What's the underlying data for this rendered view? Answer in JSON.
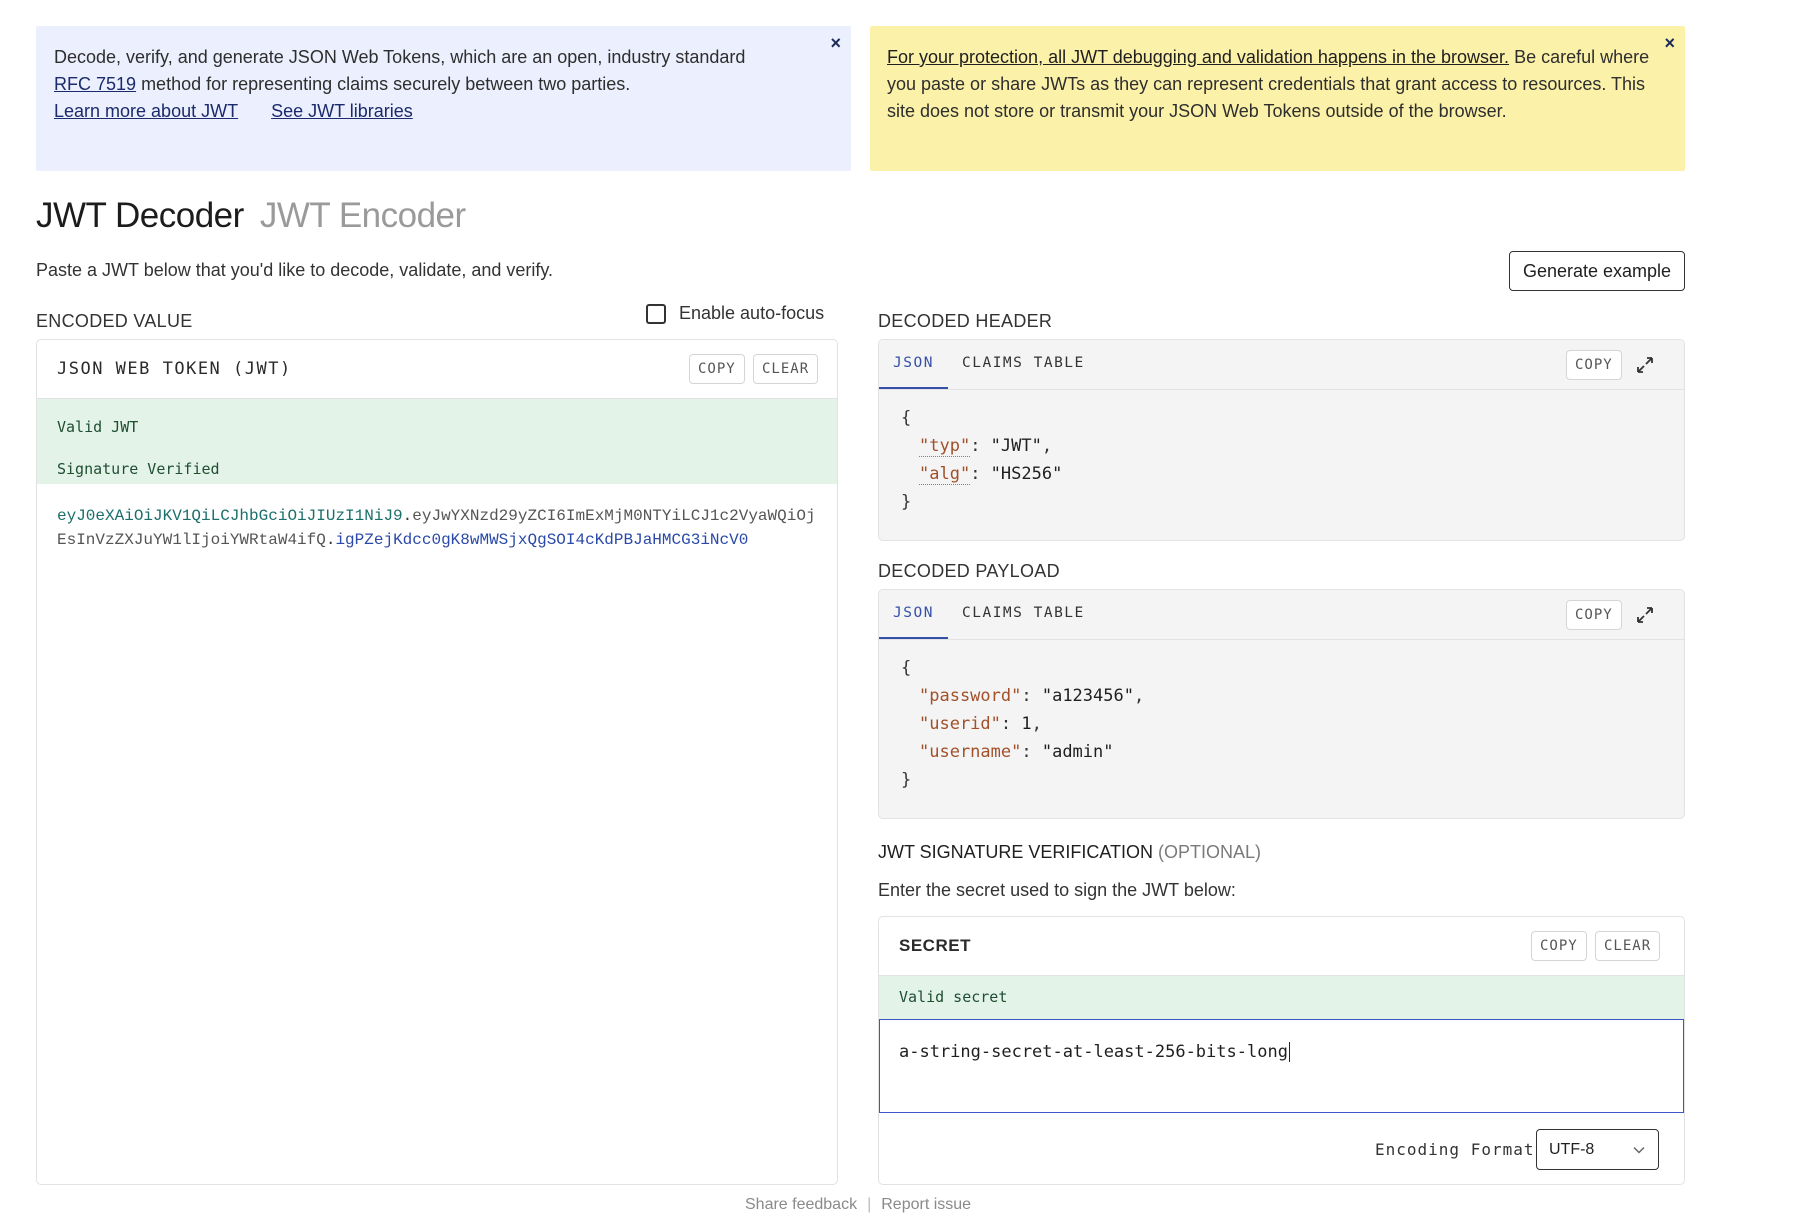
{
  "info_banner": {
    "text_before_link": "Decode, verify, and generate JSON Web Tokens, which are an open, industry standard",
    "rfc_link": "RFC 7519",
    "text_after_link": "method for representing claims securely between two parties.",
    "learn_more": "Learn more about JWT",
    "see_libraries": "See JWT libraries",
    "close": "×"
  },
  "warning_banner": {
    "lead": "For your protection, all JWT debugging and validation happens in the browser.",
    "text": "Be careful where you paste or share JWTs as they can represent credentials that grant access to resources. This site does not store or transmit your JSON Web Tokens outside of the browser.",
    "close": "×"
  },
  "title_tabs": {
    "decoder": "JWT Decoder",
    "encoder": "JWT Encoder"
  },
  "intro": "Paste a JWT below that you'd like to decode, validate, and verify.",
  "generate_example": "Generate example",
  "encoded": {
    "section_label": "ENCODED VALUE",
    "autofocus_label": "Enable auto-focus",
    "panel_title": "JSON WEB TOKEN (JWT)",
    "copy": "COPY",
    "clear": "CLEAR",
    "status_valid": "Valid JWT",
    "status_signature": "Signature Verified",
    "token_header": "eyJ0eXAiOiJKV1QiLCJhbGciOiJIUzI1NiJ9",
    "token_payload": "eyJwYXNzd29yZCI6ImExMjM0NTYiLCJ1c2VyaWQiOjEsInVzZXJuYW1lIjoiYWRtaW4ifQ",
    "token_signature": "igPZejKdcc0gK8wMWSjxQgSOI4cKdPBJaHMCG3iNcV0",
    "dot": "."
  },
  "decoded_header": {
    "section_label": "DECODED HEADER",
    "tab_json": "JSON",
    "tab_claims": "CLAIMS TABLE",
    "copy": "COPY",
    "open_brace": "{",
    "close_brace": "}",
    "line1_key": "\"typ\"",
    "line1_value": "\"JWT\"",
    "line2_key": "\"alg\"",
    "line2_value": "\"HS256\""
  },
  "decoded_payload": {
    "section_label": "DECODED PAYLOAD",
    "tab_json": "JSON",
    "tab_claims": "CLAIMS TABLE",
    "copy": "COPY",
    "open_brace": "{",
    "close_brace": "}",
    "line1_key": "\"password\"",
    "line1_value": "\"a123456\"",
    "line2_key": "\"userid\"",
    "line2_value": "1",
    "line3_key": "\"username\"",
    "line3_value": "\"admin\""
  },
  "signature": {
    "title": "JWT SIGNATURE VERIFICATION",
    "optional": "(OPTIONAL)",
    "description": "Enter the secret used to sign the JWT below:",
    "panel_title": "SECRET",
    "copy": "COPY",
    "clear": "CLEAR",
    "status": "Valid secret",
    "secret_value": "a-string-secret-at-least-256-bits-long",
    "encoding_label": "Encoding Format",
    "encoding_value": "UTF-8"
  },
  "footer": {
    "feedback": "Share feedback",
    "separator": "|",
    "report": "Report issue"
  }
}
